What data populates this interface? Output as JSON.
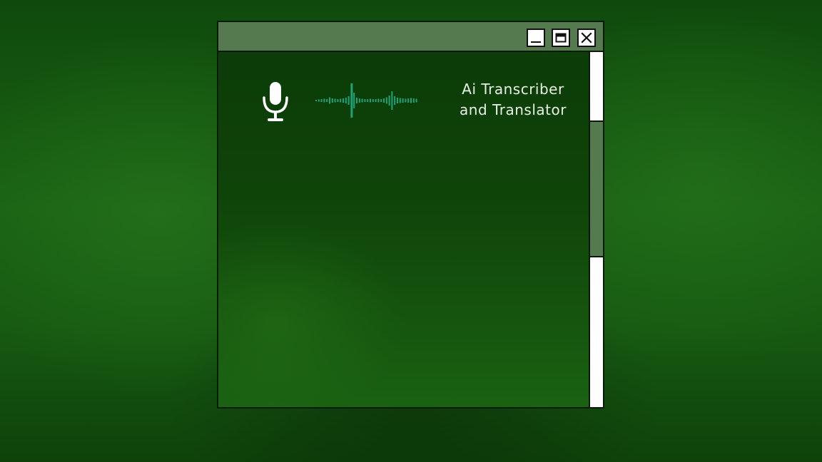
{
  "window": {
    "title_bar": {
      "buttons": [
        {
          "name": "minimize",
          "icon": "minimize-icon"
        },
        {
          "name": "maximize",
          "icon": "maximize-icon"
        },
        {
          "name": "close",
          "icon": "close-icon"
        }
      ]
    },
    "header": {
      "icon": "microphone-icon",
      "waveform_icon": "audio-waveform-icon",
      "title_line1": "Ai Transcriber",
      "title_line2": "and Translator"
    }
  },
  "colors": {
    "titlebar": "#567a4f",
    "accent_wave": "#1fa37a",
    "text": "#e8f0e6"
  }
}
